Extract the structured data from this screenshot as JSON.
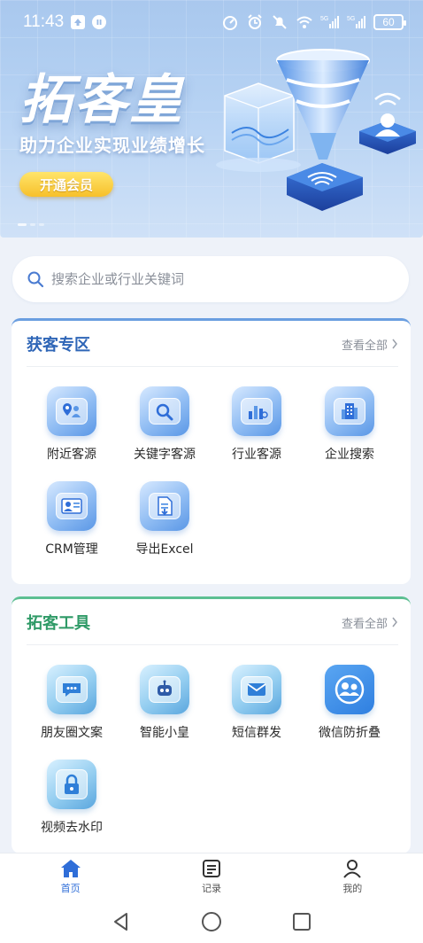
{
  "status_bar": {
    "time": "11:43",
    "battery": "60"
  },
  "banner": {
    "title": "拓客皇",
    "subtitle": "助力企业实现业绩增长",
    "vip_button": "开通会员"
  },
  "search": {
    "placeholder": "搜索企业或行业关键词",
    "value": ""
  },
  "sections": [
    {
      "title": "获客专区",
      "see_all": "查看全部",
      "items": [
        {
          "label": "附近客源",
          "icon": "nearby-customers-icon"
        },
        {
          "label": "关键字客源",
          "icon": "keyword-search-icon"
        },
        {
          "label": "行业客源",
          "icon": "industry-chart-icon"
        },
        {
          "label": "企业搜索",
          "icon": "enterprise-building-icon"
        },
        {
          "label": "CRM管理",
          "icon": "crm-contact-icon"
        },
        {
          "label": "导出Excel",
          "icon": "export-document-icon"
        }
      ]
    },
    {
      "title": "拓客工具",
      "see_all": "查看全部",
      "items": [
        {
          "label": "朋友圈文案",
          "icon": "chat-bubble-icon"
        },
        {
          "label": "智能小皇",
          "icon": "robot-icon"
        },
        {
          "label": "短信群发",
          "icon": "envelope-icon"
        },
        {
          "label": "微信防折叠",
          "icon": "wechat-users-icon"
        },
        {
          "label": "视频去水印",
          "icon": "lock-icon"
        }
      ]
    }
  ],
  "bottom_nav": [
    {
      "label": "首页",
      "icon": "home-icon",
      "active": true
    },
    {
      "label": "记录",
      "icon": "records-icon",
      "active": false
    },
    {
      "label": "我的",
      "icon": "profile-icon",
      "active": false
    }
  ],
  "colors": {
    "primary": "#2f6ed8",
    "section_blue": "#2f66b7",
    "section_green": "#2f9a67",
    "vip_gold": "#f7c02a"
  }
}
